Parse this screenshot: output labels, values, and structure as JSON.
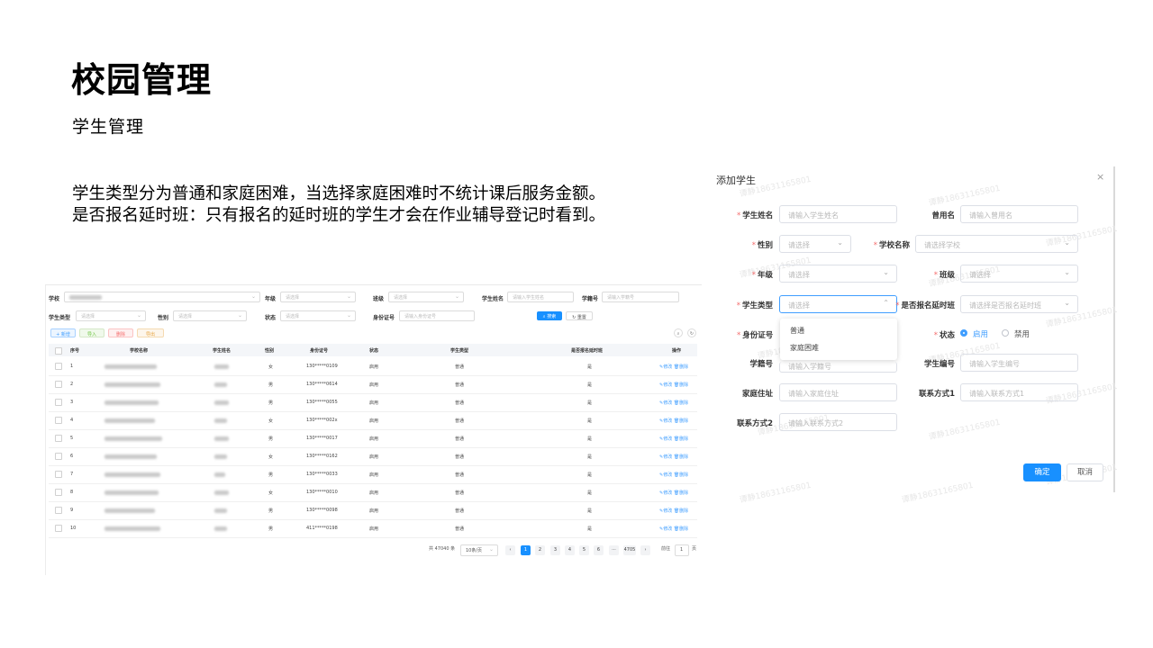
{
  "slide": {
    "title": "校园管理",
    "subtitle": "学生管理",
    "description_lines": [
      "学生类型分为普通和家庭困难，当选择家庭困难时不统计课后服务金额。",
      "是否报名延时班：只有报名的延时班的学生才会在作业辅导登记时看到。"
    ]
  },
  "list_screenshot": {
    "filters": {
      "school_label": "学校",
      "grade_label": "年级",
      "grade_placeholder": "请选择",
      "class_label": "班级",
      "class_placeholder": "请选择",
      "student_name_label": "学生姓名",
      "student_name_placeholder": "请输入学生姓名",
      "student_no_label": "学籍号",
      "student_no_placeholder": "请输入学籍号",
      "student_type_label": "学生类型",
      "student_type_placeholder": "请选择",
      "gender_label": "性别",
      "gender_placeholder": "请选择",
      "status_label": "状态",
      "status_placeholder": "请选择",
      "id_label": "身份证号",
      "id_placeholder": "请输入身份证号",
      "search_button": "搜索",
      "reset_button": "重置"
    },
    "toolbar": {
      "add": "+ 新增",
      "import": "导入",
      "delete": "删除",
      "export": "导出"
    },
    "columns": [
      "序号",
      "学校名称",
      "学生姓名",
      "性别",
      "身份证号",
      "状态",
      "学生类型",
      "是否报名延时班",
      "操作"
    ],
    "rows": [
      {
        "no": "1",
        "gender": "女",
        "id": "130*****0109",
        "status": "启用",
        "type": "普通",
        "delay": "是"
      },
      {
        "no": "2",
        "gender": "男",
        "id": "130*****0614",
        "status": "启用",
        "type": "普通",
        "delay": "是"
      },
      {
        "no": "3",
        "gender": "男",
        "id": "130*****0055",
        "status": "启用",
        "type": "普通",
        "delay": "是"
      },
      {
        "no": "4",
        "gender": "女",
        "id": "130*****002x",
        "status": "启用",
        "type": "普通",
        "delay": "是"
      },
      {
        "no": "5",
        "gender": "男",
        "id": "130*****0017",
        "status": "启用",
        "type": "普通",
        "delay": "是"
      },
      {
        "no": "6",
        "gender": "女",
        "id": "130*****0162",
        "status": "启用",
        "type": "普通",
        "delay": "是"
      },
      {
        "no": "7",
        "gender": "男",
        "id": "130*****0033",
        "status": "启用",
        "type": "普通",
        "delay": "是"
      },
      {
        "no": "8",
        "gender": "女",
        "id": "130*****0010",
        "status": "启用",
        "type": "普通",
        "delay": "是"
      },
      {
        "no": "9",
        "gender": "男",
        "id": "130*****0098",
        "status": "启用",
        "type": "普通",
        "delay": "是"
      },
      {
        "no": "10",
        "gender": "男",
        "id": "411*****0198",
        "status": "启用",
        "type": "普通",
        "delay": "是"
      }
    ],
    "row_actions": {
      "edit": "修改",
      "delete": "删除"
    },
    "pagination": {
      "total": "共 47040 条",
      "page_size": "10条/页",
      "pages": [
        "1",
        "2",
        "3",
        "4",
        "5",
        "6",
        "···",
        "4705"
      ],
      "goto_prefix": "前往",
      "goto_value": "1",
      "goto_suffix": "页"
    }
  },
  "dialog": {
    "title": "添加学生",
    "close": "×",
    "fields": {
      "student_name": {
        "label": "学生姓名",
        "placeholder": "请输入学生姓名"
      },
      "former_name": {
        "label": "曾用名",
        "placeholder": "请输入曾用名"
      },
      "gender": {
        "label": "性别",
        "placeholder": "请选择"
      },
      "school_name": {
        "label": "学校名称",
        "placeholder": "请选择学校"
      },
      "grade": {
        "label": "年级",
        "placeholder": "请选择"
      },
      "class": {
        "label": "班级",
        "placeholder": "请选择"
      },
      "student_type": {
        "label": "学生类型",
        "placeholder": "请选择"
      },
      "delay_class": {
        "label": "是否报名延时班",
        "placeholder": "请选择是否报名延时班"
      },
      "id_no": {
        "label": "身份证号"
      },
      "status": {
        "label": "状态",
        "option_on": "启用",
        "option_off": "禁用"
      },
      "student_no": {
        "label": "学籍号",
        "placeholder": "请输入学籍号"
      },
      "student_code": {
        "label": "学生编号",
        "placeholder": "请输入学生编号"
      },
      "address": {
        "label": "家庭住址",
        "placeholder": "请输入家庭住址"
      },
      "contact1": {
        "label": "联系方式1",
        "placeholder": "请输入联系方式1"
      },
      "contact2": {
        "label": "联系方式2",
        "placeholder": "请输入联系方式2"
      }
    },
    "type_options": [
      "普通",
      "家庭困难"
    ],
    "confirm": "确定",
    "cancel": "取消"
  },
  "watermark": "谭静18631165801",
  "colors": {
    "primary": "#409eff",
    "required": "#f56c6c"
  }
}
